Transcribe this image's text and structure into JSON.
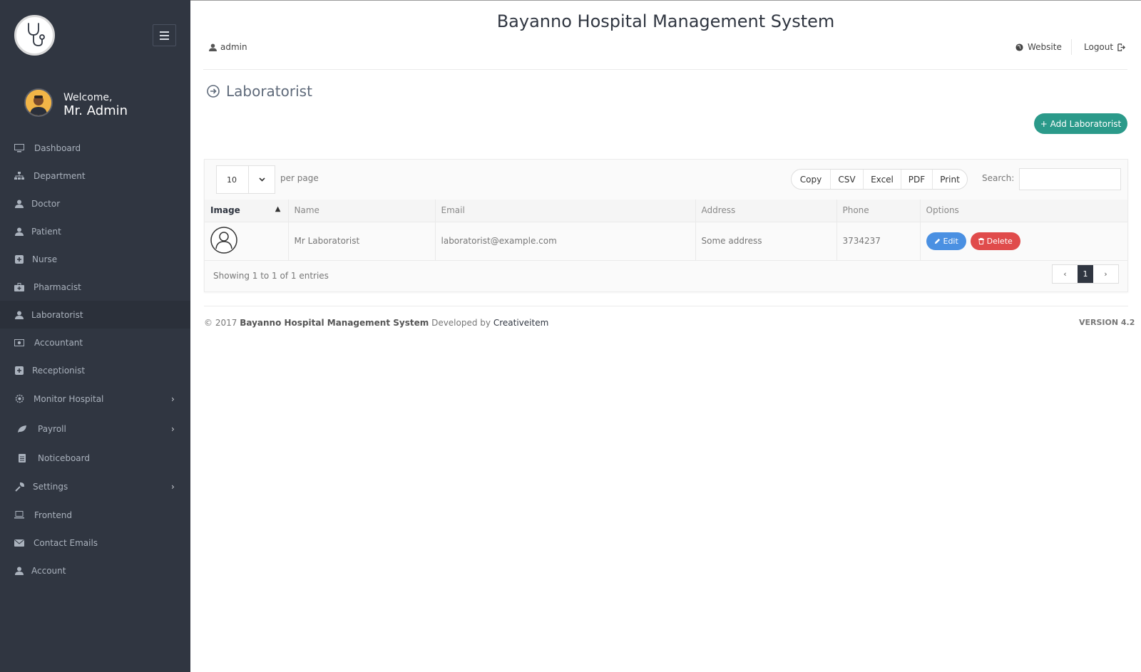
{
  "app_title": "Bayanno Hospital Management System",
  "header": {
    "user": "admin",
    "website_label": "Website",
    "logout_label": "Logout"
  },
  "sidebar": {
    "welcome": "Welcome,",
    "user_name": "Mr. Admin",
    "items": [
      {
        "label": "Dashboard",
        "icon": "monitor-icon"
      },
      {
        "label": "Department",
        "icon": "sitemap-icon"
      },
      {
        "label": "Doctor",
        "icon": "user-md-icon"
      },
      {
        "label": "Patient",
        "icon": "user-icon"
      },
      {
        "label": "Nurse",
        "icon": "plus-square-icon"
      },
      {
        "label": "Pharmacist",
        "icon": "medkit-icon"
      },
      {
        "label": "Laboratorist",
        "icon": "user-icon",
        "active": true
      },
      {
        "label": "Accountant",
        "icon": "money-icon"
      },
      {
        "label": "Receptionist",
        "icon": "plus-square-icon"
      },
      {
        "label": "Monitor Hospital",
        "icon": "gear-icon",
        "has_submenu": true
      },
      {
        "label": "Payroll",
        "icon": "leaf-icon",
        "has_submenu": true
      },
      {
        "label": "Noticeboard",
        "icon": "file-icon"
      },
      {
        "label": "Settings",
        "icon": "wrench-icon",
        "has_submenu": true
      },
      {
        "label": "Frontend",
        "icon": "laptop-icon"
      },
      {
        "label": "Contact Emails",
        "icon": "envelope-icon"
      },
      {
        "label": "Account",
        "icon": "user-icon"
      }
    ]
  },
  "page": {
    "title": "Laboratorist",
    "add_button": "+ Add Laboratorist"
  },
  "table_controls": {
    "per_page_value": "10",
    "per_page_label": "per page",
    "export_buttons": [
      "Copy",
      "CSV",
      "Excel",
      "PDF",
      "Print"
    ],
    "search_label": "Search:",
    "search_value": ""
  },
  "table": {
    "columns": [
      "Image",
      "Name",
      "Email",
      "Address",
      "Phone",
      "Options"
    ],
    "rows": [
      {
        "name": "Mr Laboratorist",
        "email": "laboratorist@example.com",
        "address": "Some address",
        "phone": "3734237"
      }
    ],
    "edit_label": "Edit",
    "delete_label": "Delete",
    "showing": "Showing 1 to 1 of 1 entries",
    "current_page": "1"
  },
  "footer": {
    "copyright": "© 2017",
    "system_name": "Bayanno Hospital Management System",
    "developed_by": "Developed by",
    "developer": "Creativeitem",
    "version": "VERSION 4.2"
  },
  "colors": {
    "sidebar_bg": "#303641",
    "accent_green": "#2b9a8a",
    "edit_blue": "#4a90e2",
    "delete_red": "#e04b4b"
  }
}
